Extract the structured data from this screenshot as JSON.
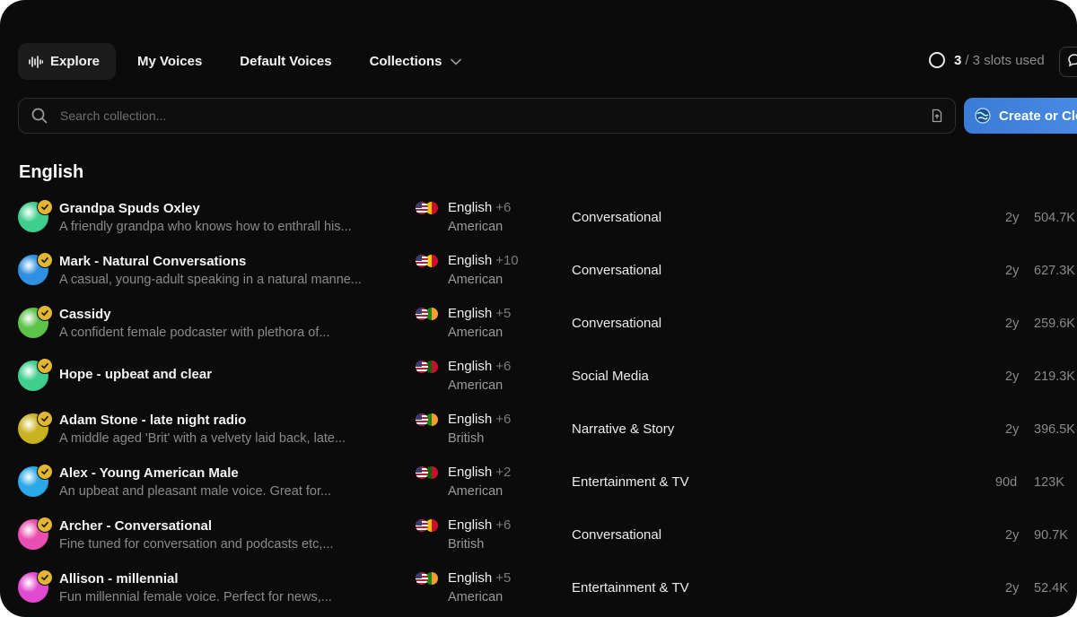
{
  "nav": {
    "tabs": [
      {
        "label": "Explore",
        "active": true
      },
      {
        "label": "My Voices"
      },
      {
        "label": "Default Voices"
      },
      {
        "label": "Collections"
      }
    ],
    "slots_used": "3",
    "slots_total": "/ 3 slots used"
  },
  "search": {
    "placeholder": "Search collection..."
  },
  "create_button": "Create or Clone",
  "section_title": "English",
  "voices": [
    {
      "name": "Grandpa Spuds Oxley",
      "description": "A friendly grandpa who knows how to enthrall his...",
      "language": "English",
      "more": "+6",
      "accent": "American",
      "category": "Conversational",
      "age": "2y",
      "uses": "504.7K"
    },
    {
      "name": "Mark - Natural Conversations",
      "description": "A casual, young-adult speaking in a natural manne...",
      "language": "English",
      "more": "+10",
      "accent": "American",
      "category": "Conversational",
      "age": "2y",
      "uses": "627.3K"
    },
    {
      "name": "Cassidy",
      "description": "A confident female podcaster with plethora of...",
      "language": "English",
      "more": "+5",
      "accent": "American",
      "category": "Conversational",
      "age": "2y",
      "uses": "259.6K"
    },
    {
      "name": "Hope - upbeat and clear",
      "description": "",
      "language": "English",
      "more": "+6",
      "accent": "American",
      "category": "Social Media",
      "age": "2y",
      "uses": "219.3K"
    },
    {
      "name": "Adam Stone - late night radio",
      "description": "A middle aged 'Brit' with a velvety laid back, late...",
      "language": "English",
      "more": "+6",
      "accent": "British",
      "category": "Narrative & Story",
      "age": "2y",
      "uses": "396.5K"
    },
    {
      "name": "Alex - Young American Male",
      "description": "An upbeat and pleasant male voice. Great for...",
      "language": "English",
      "more": "+2",
      "accent": "American",
      "category": "Entertainment & TV",
      "age": "90d",
      "uses": "123K"
    },
    {
      "name": "Archer - Conversational",
      "description": "Fine tuned for conversation and podcasts etc,...",
      "language": "English",
      "more": "+6",
      "accent": "British",
      "category": "Conversational",
      "age": "2y",
      "uses": "90.7K"
    },
    {
      "name": "Allison - millennial",
      "description": "Fun millennial female voice. Perfect for news,...",
      "language": "English",
      "more": "+5",
      "accent": "American",
      "category": "Entertainment & TV",
      "age": "2y",
      "uses": "52.4K"
    }
  ],
  "colors": {
    "background": "#0b0b0b",
    "accent_button": "#3a7bd5",
    "verified_badge": "#e2b533",
    "avatars": [
      "#3ecf8e",
      "#2f8fe0",
      "#5cc34a",
      "#3ecf8e",
      "#c9b21f",
      "#2aa8e8",
      "#e94fb0",
      "#e14ad0"
    ]
  }
}
